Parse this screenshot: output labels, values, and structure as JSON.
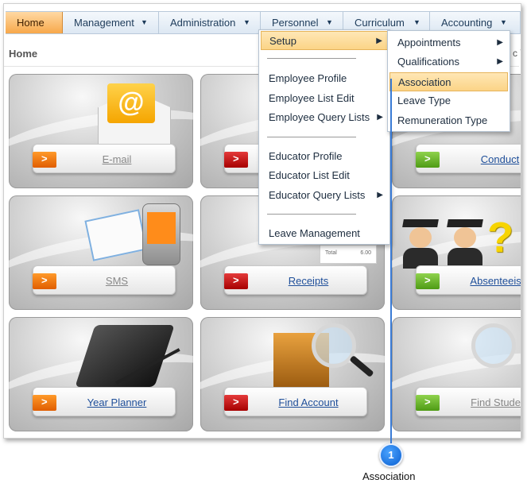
{
  "menu": {
    "items": [
      {
        "label": "Home"
      },
      {
        "label": "Management"
      },
      {
        "label": "Administration"
      },
      {
        "label": "Personnel"
      },
      {
        "label": "Curriculum"
      },
      {
        "label": "Accounting"
      }
    ]
  },
  "page": {
    "title": "Home",
    "right_text": "c Y"
  },
  "tiles": [
    {
      "label": "E-mail",
      "icon": "email-icon",
      "arrow_color": "orange"
    },
    {
      "label": "",
      "icon": "",
      "arrow_color": "red"
    },
    {
      "label": "Conduct",
      "icon": "conduct-icon",
      "arrow_color": "green"
    },
    {
      "label": "SMS",
      "icon": "sms-icon",
      "arrow_color": "orange"
    },
    {
      "label": "Receipts",
      "icon": "receipt-icon",
      "arrow_color": "red",
      "receipt_total_label": "Total",
      "receipt_total_value": "6.00"
    },
    {
      "label": "Absenteeism",
      "icon": "absenteeism-icon",
      "arrow_color": "green"
    },
    {
      "label": "Year Planner",
      "icon": "planner-icon",
      "arrow_color": "orange"
    },
    {
      "label": "Find Account",
      "icon": "find-account-icon",
      "arrow_color": "red"
    },
    {
      "label": "Find Student",
      "icon": "find-student-icon",
      "arrow_color": "green"
    }
  ],
  "personnel_menu": {
    "items": [
      {
        "label": "Setup",
        "has_sub": true,
        "highlighted": true
      },
      {
        "label": "Employee Profile"
      },
      {
        "label": "Employee List Edit"
      },
      {
        "label": "Employee Query Lists",
        "has_sub": true
      },
      {
        "label": "Educator Profile"
      },
      {
        "label": "Educator List Edit"
      },
      {
        "label": "Educator Query Lists",
        "has_sub": true
      },
      {
        "label": "Leave Management"
      }
    ]
  },
  "setup_menu": {
    "items": [
      {
        "label": "Appointments",
        "has_sub": true
      },
      {
        "label": "Qualifications",
        "has_sub": true
      },
      {
        "label": "Association",
        "highlighted": true
      },
      {
        "label": "Leave Type"
      },
      {
        "label": "Remuneration Type"
      }
    ]
  },
  "callout": {
    "number": "1",
    "text": "Association"
  },
  "colors": {
    "accent_orange": "#f7a84a",
    "menu_blue": "#1d3b5a",
    "highlight": "#fbd487",
    "callout_blue": "#0a5fd0"
  }
}
